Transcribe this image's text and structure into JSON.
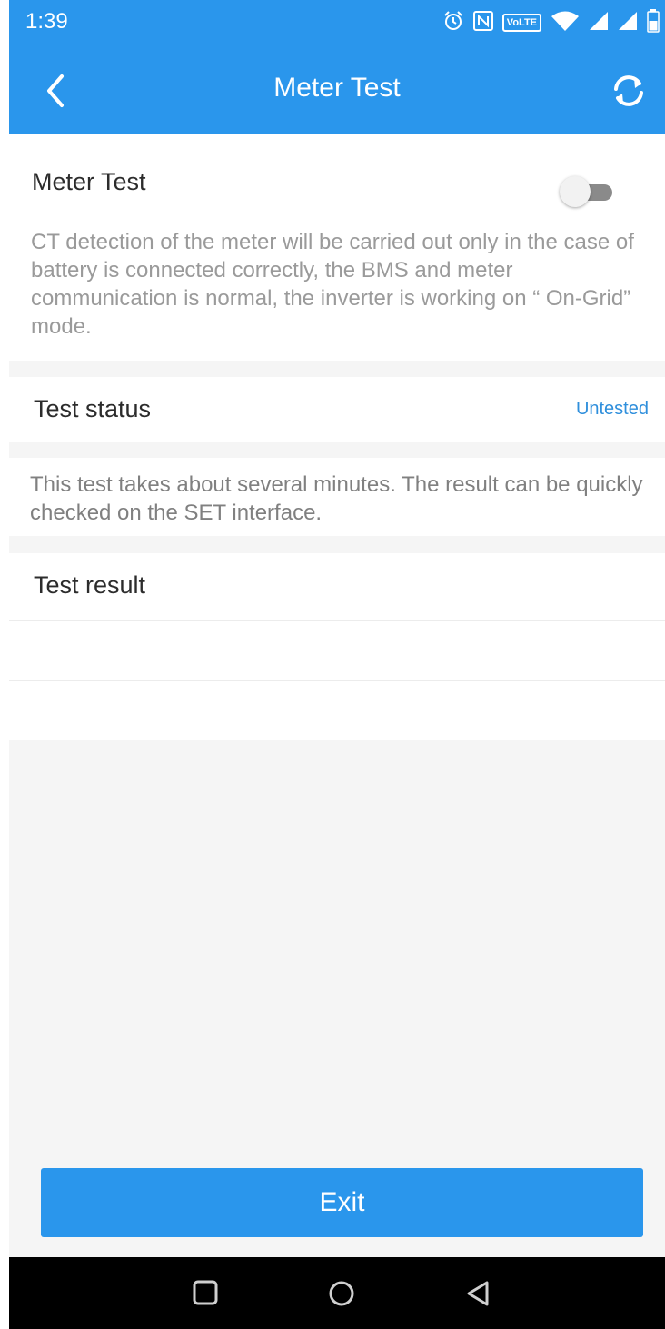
{
  "status_bar": {
    "time": "1:39",
    "volte_badge": "VoLTE",
    "icons": [
      "alarm-icon",
      "nfc-icon",
      "volte-icon",
      "wifi-icon",
      "signal-icon",
      "signal-icon",
      "battery-icon"
    ]
  },
  "app_bar": {
    "title": "Meter Test",
    "back_icon": "chevron-left-icon",
    "refresh_icon": "refresh-icon"
  },
  "meter_test": {
    "label": "Meter Test",
    "toggle_on": false,
    "description": "CT detection of the meter will be carried out only in the case of battery is connected correctly, the BMS and meter communication is normal, the inverter is working on “ On-Grid” mode."
  },
  "test_status": {
    "label": "Test status",
    "value": "Untested"
  },
  "note": "This test takes about several minutes. The result can be quickly checked on the SET interface.",
  "test_result": {
    "label": "Test result"
  },
  "exit_label": "Exit",
  "nav_bar": {
    "icons": [
      "recents-square-icon",
      "home-circle-icon",
      "back-triangle-icon"
    ]
  },
  "colors": {
    "primary": "#2a96ec",
    "status_value": "#2f8fdc",
    "background": "#f5f5f5"
  }
}
